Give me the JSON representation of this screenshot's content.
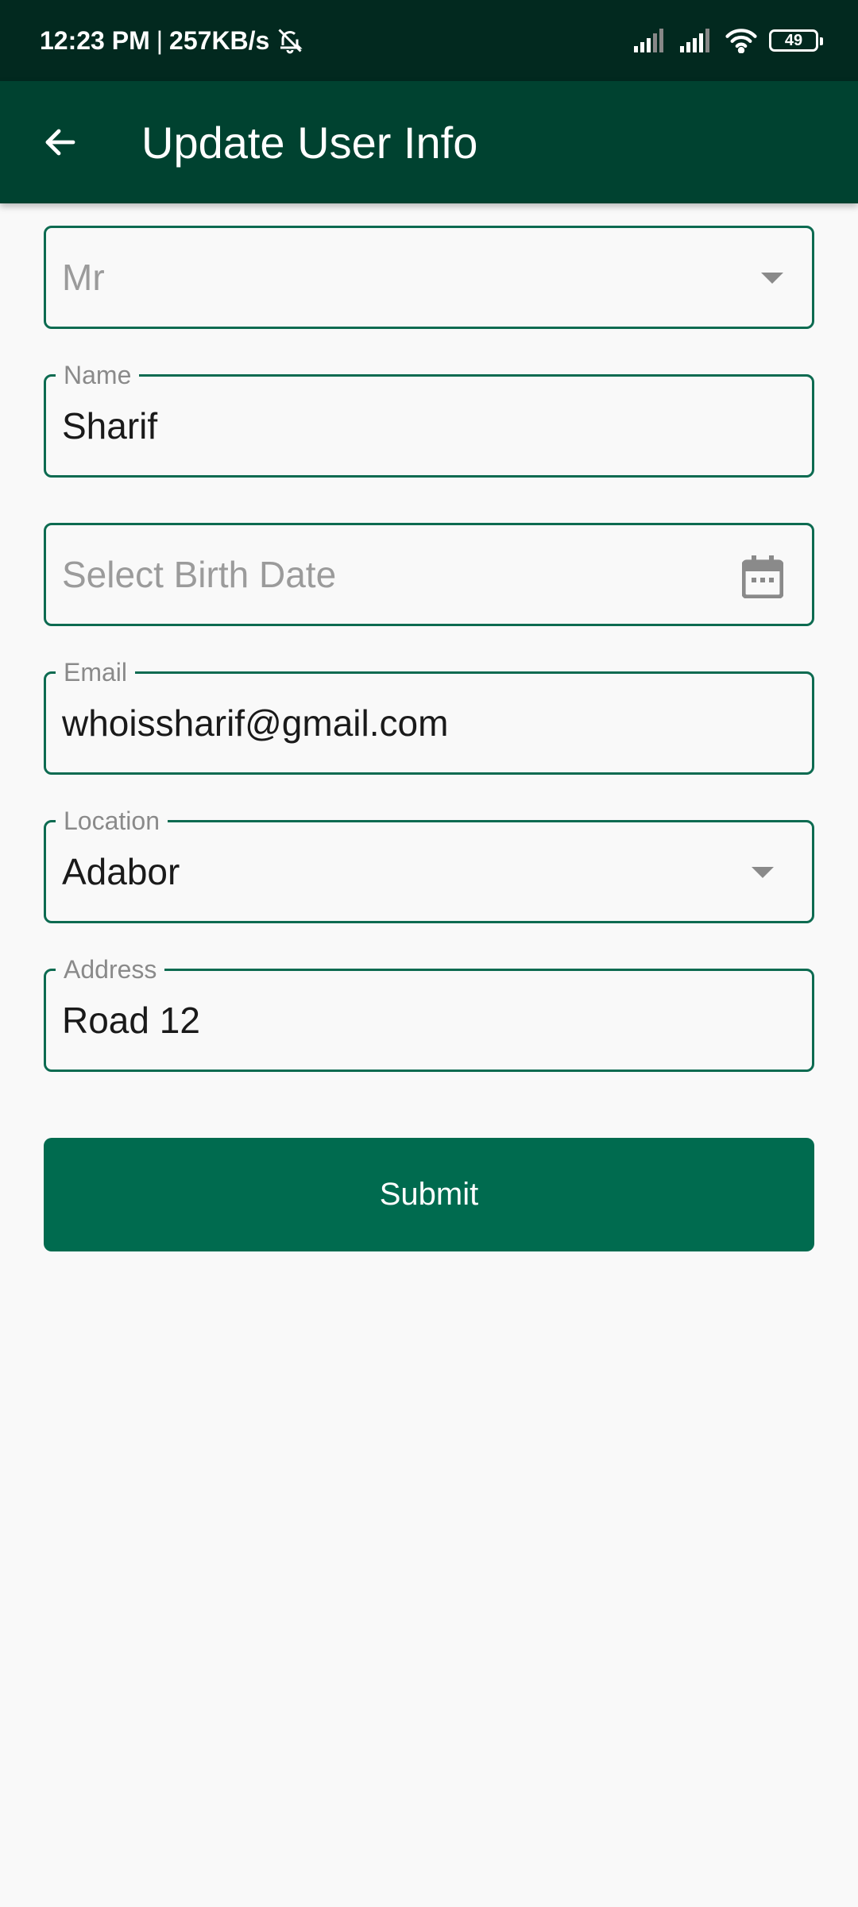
{
  "status_bar": {
    "time": "12:23 PM",
    "separator": "|",
    "speed": "257KB/s",
    "battery": "49",
    "icons": [
      "bell-off-icon",
      "signal-icon",
      "signal-icon",
      "wifi-icon",
      "battery-icon"
    ]
  },
  "app_bar": {
    "title": "Update User Info",
    "back_icon": "arrow-left-icon",
    "background": "#004230"
  },
  "form": {
    "salutation": {
      "value": "Mr"
    },
    "name": {
      "label": "Name",
      "value": "Sharif"
    },
    "birth_date": {
      "placeholder": "Select Birth Date",
      "icon": "calendar-icon"
    },
    "email": {
      "label": "Email",
      "value": "whoissharif@gmail.com"
    },
    "location": {
      "label": "Location",
      "value": "Adabor"
    },
    "address": {
      "label": "Address",
      "value": "Road 12"
    }
  },
  "submit": {
    "label": "Submit",
    "color": "#006b4f"
  },
  "colors": {
    "accent": "#0d6b51",
    "status_bar": "#02291f",
    "page_bg": "#f9f9f9"
  }
}
